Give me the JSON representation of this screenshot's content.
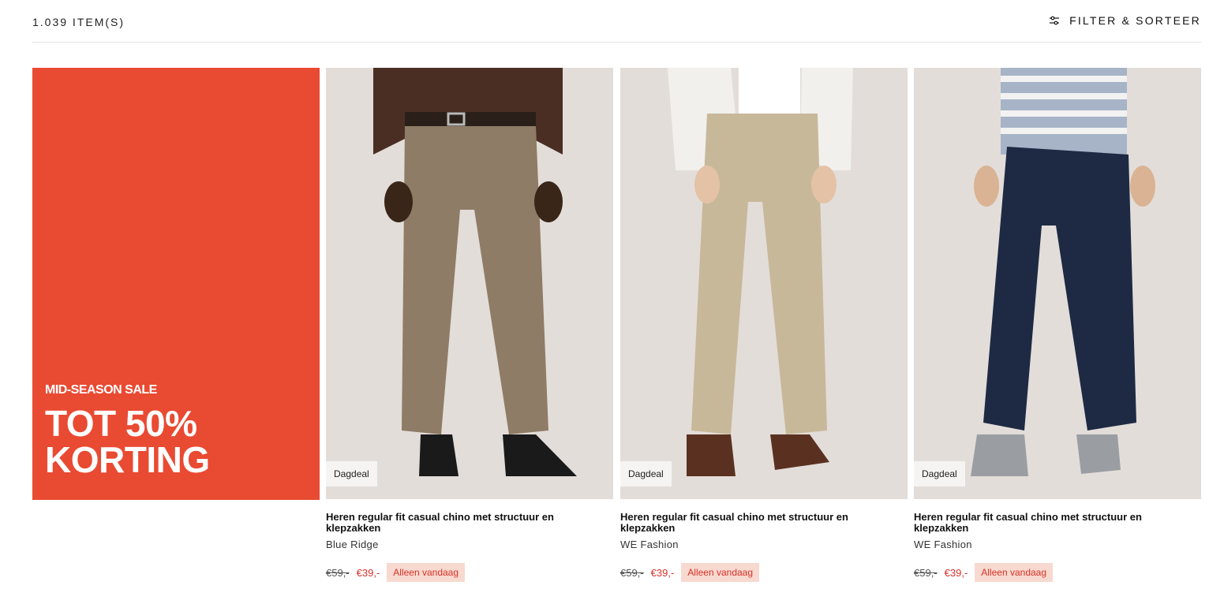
{
  "header": {
    "item_count": "1.039 ITEM(S)",
    "filter_label": "FILTER & SORTEER"
  },
  "promo": {
    "subtitle": "MID-SEASON SALE",
    "title_line1": "TOT 50%",
    "title_line2": "KORTING",
    "color": "#e94a32"
  },
  "products": [
    {
      "badge": "Dagdeal",
      "name": "Heren regular fit casual chino met structuur en klepzakken",
      "brand": "Blue Ridge",
      "old_price": "€59,-",
      "price": "€39,-",
      "tag": "Alleen vandaag",
      "pants_color": "#8f7c66"
    },
    {
      "badge": "Dagdeal",
      "name": "Heren regular fit casual chino met structuur en klepzakken",
      "brand": "WE Fashion",
      "old_price": "€59,-",
      "price": "€39,-",
      "tag": "Alleen vandaag",
      "pants_color": "#c8b89a"
    },
    {
      "badge": "Dagdeal",
      "name": "Heren regular fit casual chino met structuur en klepzakken",
      "brand": "WE Fashion",
      "old_price": "€59,-",
      "price": "€39,-",
      "tag": "Alleen vandaag",
      "pants_color": "#1e2a44"
    }
  ]
}
